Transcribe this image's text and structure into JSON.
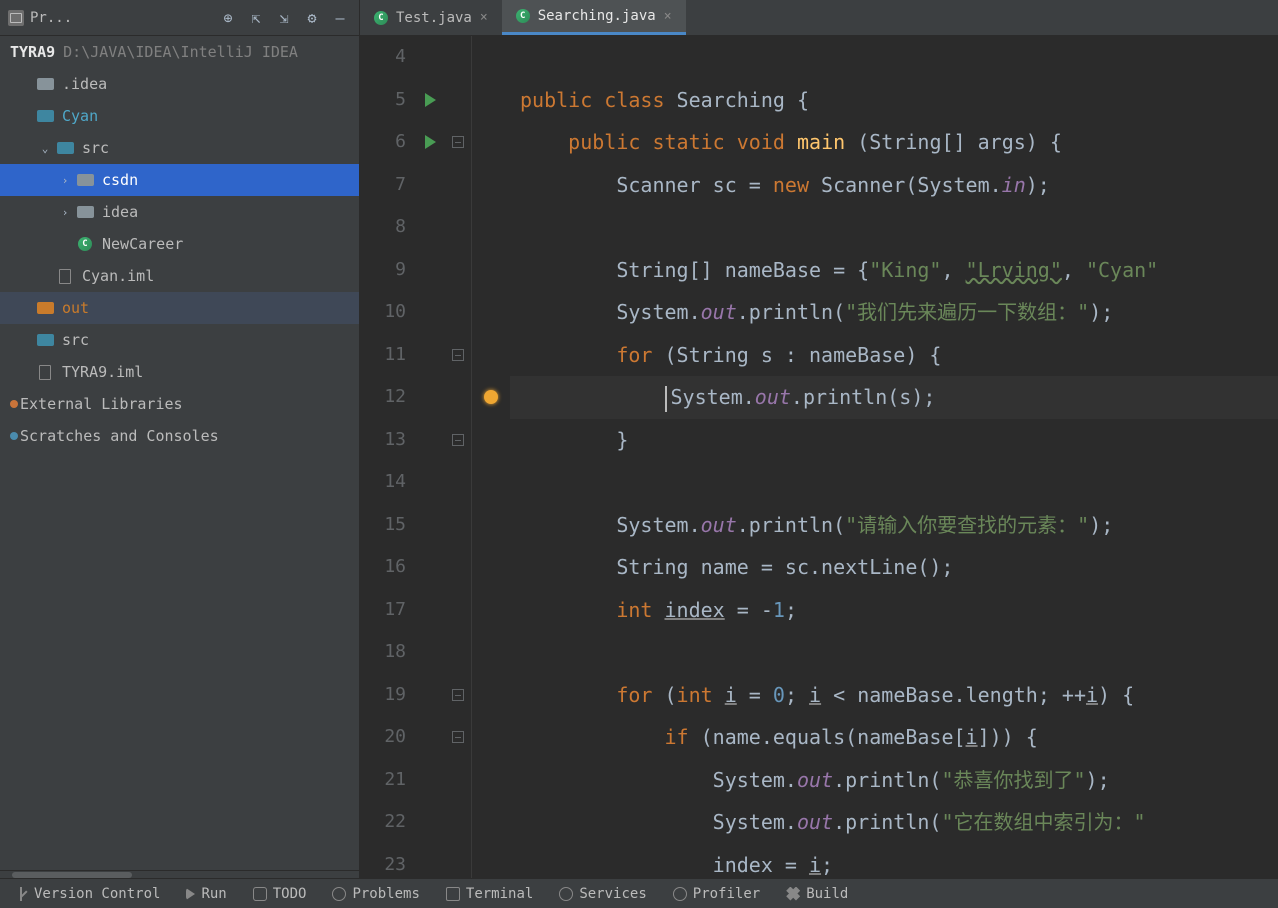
{
  "sidebar": {
    "project_label": "Pr...",
    "path_project": "TYRA9",
    "path_text": "D:\\JAVA\\IDEA\\IntelliJ IDEA",
    "items": {
      "idea_folder": ".idea",
      "cyan": "Cyan",
      "src": "src",
      "csdn": "csdn",
      "idea_pkg": "idea",
      "newcareer": "NewCareer",
      "cyan_iml": "Cyan.iml",
      "out": "out",
      "src2": "src",
      "tyra_iml": "TYRA9.iml",
      "ext_lib": "External Libraries",
      "scratches": "Scratches and Consoles"
    }
  },
  "tabs": {
    "t1": "Test.java",
    "t2": "Searching.java"
  },
  "gutter": {
    "start": 4,
    "end": 23
  },
  "code": {
    "l5": {
      "kw1": "public",
      "kw2": "class",
      "cls": "Searching",
      "br": "{"
    },
    "l6": {
      "kw1": "public",
      "kw2": "static",
      "kw3": "void",
      "fn": "main",
      "args": "(String[] args) {"
    },
    "l7": {
      "a": "Scanner sc = ",
      "kw": "new",
      "b": " Scanner(System.",
      "fld": "in",
      "c": ");"
    },
    "l9": {
      "a": "String[] nameBase = {",
      "s1": "\"King\"",
      "c1": ", ",
      "s2": "\"Lrving\"",
      "c2": ", ",
      "s3": "\"Cyan\""
    },
    "l10": {
      "a": "System.",
      "fld": "out",
      "b": ".println(",
      "s": "\"我们先来遍历一下数组：\"",
      "c": ");"
    },
    "l11": {
      "kw": "for",
      "a": " (String s : nameBase) {"
    },
    "l12": {
      "a": "System.",
      "fld": "out",
      "b": ".println(s);"
    },
    "l13": {
      "a": "}"
    },
    "l15": {
      "a": "System.",
      "fld": "out",
      "b": ".println(",
      "s": "\"请输入你要查找的元素：\"",
      "c": ");"
    },
    "l16": {
      "a": "String name = sc.nextLine();"
    },
    "l17": {
      "kw": "int",
      "var": "index",
      "a": " = -",
      "n": "1",
      "b": ";"
    },
    "l19": {
      "kw1": "for",
      "a": " (",
      "kw2": "int",
      "v1": "i",
      "b": " = ",
      "n": "0",
      "c": "; ",
      "v2": "i",
      "d": " < nameBase.length; ++",
      "v3": "i",
      "e": ") {"
    },
    "l20": {
      "kw": "if",
      "a": " (name.equals(nameBase[",
      "v": "i",
      "b": "])) {"
    },
    "l21": {
      "a": "System.",
      "fld": "out",
      "b": ".println(",
      "s": "\"恭喜你找到了\"",
      "c": ");"
    },
    "l22": {
      "a": "System.",
      "fld": "out",
      "b": ".println(",
      "s": "\"它在数组中索引为：\""
    },
    "l23": {
      "a": "index = ",
      "v": "i",
      "b": ";"
    }
  },
  "bottom": {
    "vc": "Version Control",
    "run": "Run",
    "todo": "TODO",
    "problems": "Problems",
    "terminal": "Terminal",
    "services": "Services",
    "profiler": "Profiler",
    "build": "Build"
  }
}
